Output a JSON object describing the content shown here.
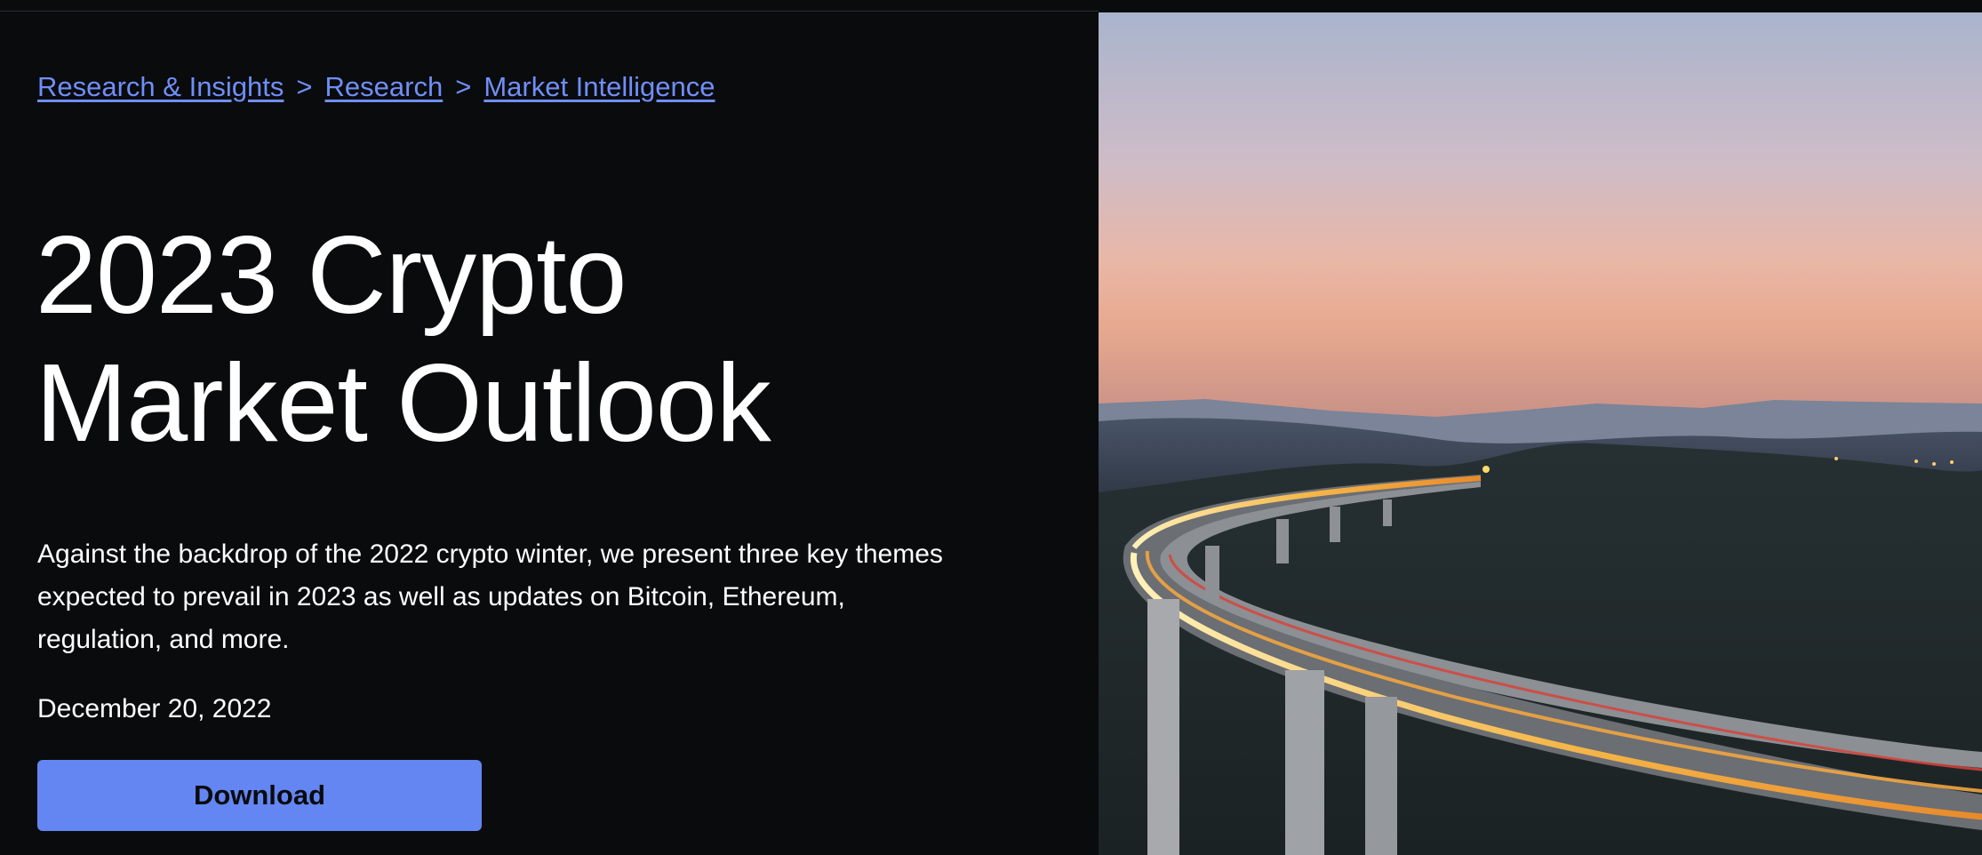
{
  "breadcrumb": {
    "items": [
      "Research & Insights",
      "Research",
      "Market Intelligence"
    ],
    "separator": ">"
  },
  "hero": {
    "title_line1": "2023 Crypto",
    "title_line2": "Market Outlook",
    "description": "Against the backdrop of the 2022 crypto winter, we present three key themes expected to prevail in 2023 as well as updates on Bitcoin, Ethereum, regulation, and more.",
    "date": "December 20, 2022",
    "download_label": "Download"
  },
  "image": {
    "subject": "hero-photo-highway-bridge-at-dusk"
  },
  "colors": {
    "background": "#0a0b0d",
    "link": "#6f8ff7",
    "button": "#6386f2",
    "text": "#ffffff"
  }
}
